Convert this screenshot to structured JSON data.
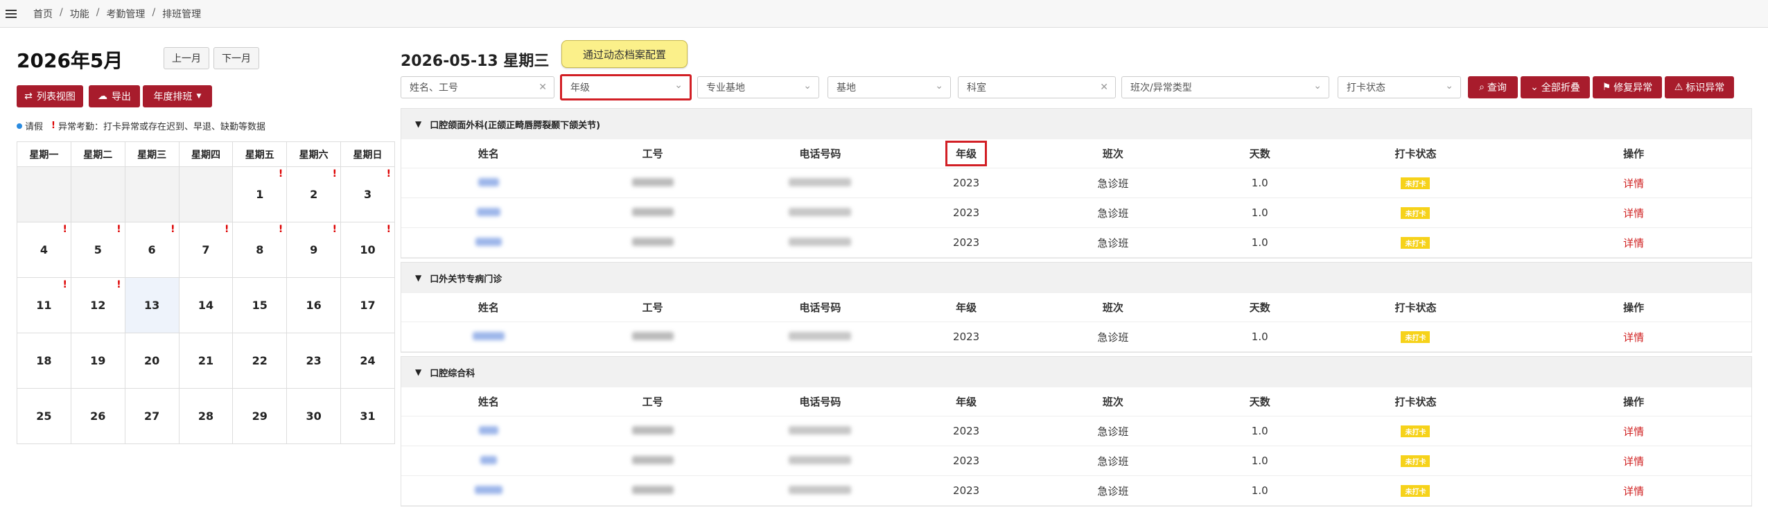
{
  "breadcrumb": [
    "首页",
    "功能",
    "考勤管理",
    "排班管理"
  ],
  "calendar": {
    "title": "2026年5月",
    "prev_label": "上一月",
    "next_label": "下一月",
    "list_view_label": "列表视图",
    "export_label": "导出",
    "yearly_label": "年度排班",
    "legend_leave": "请假",
    "legend_abnormal": "异常考勤：打卡异常或存在迟到、早退、缺勤等数据",
    "weekdays": [
      "星期一",
      "星期二",
      "星期三",
      "星期四",
      "星期五",
      "星期六",
      "星期日"
    ],
    "weeks": [
      [
        {
          "d": ""
        },
        {
          "d": ""
        },
        {
          "d": ""
        },
        {
          "d": ""
        },
        {
          "d": "1",
          "m": "!"
        },
        {
          "d": "2",
          "m": "!"
        },
        {
          "d": "3",
          "m": "!"
        }
      ],
      [
        {
          "d": "4",
          "m": "!"
        },
        {
          "d": "5",
          "m": "!"
        },
        {
          "d": "6",
          "m": "!"
        },
        {
          "d": "7",
          "m": "!"
        },
        {
          "d": "8",
          "m": "!"
        },
        {
          "d": "9",
          "m": "!"
        },
        {
          "d": "10",
          "m": "!"
        }
      ],
      [
        {
          "d": "11",
          "m": "!"
        },
        {
          "d": "12",
          "m": "!"
        },
        {
          "d": "13"
        },
        {
          "d": "14"
        },
        {
          "d": "15"
        },
        {
          "d": "16"
        },
        {
          "d": "17"
        }
      ],
      [
        {
          "d": "18"
        },
        {
          "d": "19"
        },
        {
          "d": "20"
        },
        {
          "d": "21"
        },
        {
          "d": "22"
        },
        {
          "d": "23"
        },
        {
          "d": "24"
        }
      ],
      [
        {
          "d": "25"
        },
        {
          "d": "26"
        },
        {
          "d": "27"
        },
        {
          "d": "28"
        },
        {
          "d": "29"
        },
        {
          "d": "30"
        },
        {
          "d": "31"
        }
      ]
    ]
  },
  "detail": {
    "title": "2026-05-13 星期三",
    "tooltip": "通过动态档案配置",
    "filters": {
      "name_placeholder": "姓名、工号",
      "grade": "年级",
      "base_major": "专业基地",
      "base": "基地",
      "dept": "科室",
      "shift_type": "班次/异常类型",
      "punch_status": "打卡状态"
    },
    "actions": {
      "query": "查询",
      "collapse_all": "全部折叠",
      "fix_abnormal": "修复异常",
      "mark_abnormal": "标识异常"
    },
    "columns": [
      "姓名",
      "工号",
      "电话号码",
      "年级",
      "班次",
      "天数",
      "打卡状态",
      "操作"
    ],
    "sections": [
      {
        "name": "口腔颌面外科(正颌正畸唇腭裂颞下颌关节)",
        "rows": [
          {
            "grade": "2023",
            "shift": "急诊班",
            "days": "1.0",
            "status": "未打卡",
            "op": "详情"
          },
          {
            "grade": "2023",
            "shift": "急诊班",
            "days": "1.0",
            "status": "未打卡",
            "op": "详情"
          },
          {
            "grade": "2023",
            "shift": "急诊班",
            "days": "1.0",
            "status": "未打卡",
            "op": "详情"
          }
        ]
      },
      {
        "name": "口外关节专病门诊",
        "rows": [
          {
            "grade": "2023",
            "shift": "急诊班",
            "days": "1.0",
            "status": "未打卡",
            "op": "详情"
          }
        ]
      },
      {
        "name": "口腔综合科",
        "rows": [
          {
            "grade": "2023",
            "shift": "急诊班",
            "days": "1.0",
            "status": "未打卡",
            "op": "详情"
          },
          {
            "grade": "2023",
            "shift": "急诊班",
            "days": "1.0",
            "status": "未打卡",
            "op": "详情"
          },
          {
            "grade": "2023",
            "shift": "急诊班",
            "days": "1.0",
            "status": "未打卡",
            "op": "详情"
          }
        ]
      }
    ]
  },
  "colors": {
    "primary": "#a81c2c",
    "highlight": "#d21f25",
    "tooltip": "#fbf08a",
    "badge": "#f6d21a"
  }
}
